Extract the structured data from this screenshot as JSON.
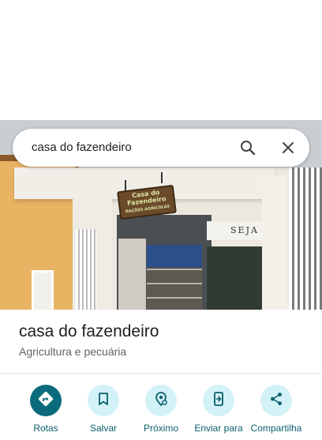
{
  "search": {
    "query": "casa do fazendeiro"
  },
  "photo": {
    "sign_line1": "Casa do",
    "sign_line2": "Fazendeiro",
    "sign_line3": "RAÇÕES  AGRÍCOLAS",
    "wall_text": "SEJA"
  },
  "place": {
    "title": "casa do fazendeiro",
    "category": "Agricultura e pecuária"
  },
  "actions": [
    {
      "label": "Rotas",
      "icon": "directions-icon"
    },
    {
      "label": "Salvar",
      "icon": "bookmark-icon"
    },
    {
      "label": "Próximo",
      "icon": "nearby-icon"
    },
    {
      "label": "Enviar para",
      "icon": "send-to-phone-icon"
    },
    {
      "label": "Compartilha",
      "icon": "share-icon"
    }
  ],
  "colors": {
    "accent": "#0b6b7c",
    "action_bg": "#d3f2f8",
    "label": "#0b5f6c"
  }
}
